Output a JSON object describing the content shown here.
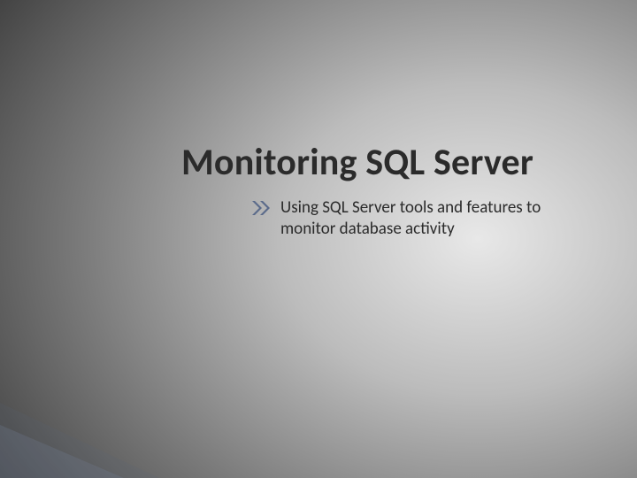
{
  "slide": {
    "title": "Monitoring SQL Server",
    "subtitle": "Using SQL Server tools and features to monitor database activity",
    "bullet_icon": "double-chevron-right",
    "colors": {
      "title_text": "#2b2b2b",
      "subtitle_text": "#2b2b2b",
      "chevron_fill": "#5a6a8a"
    }
  }
}
